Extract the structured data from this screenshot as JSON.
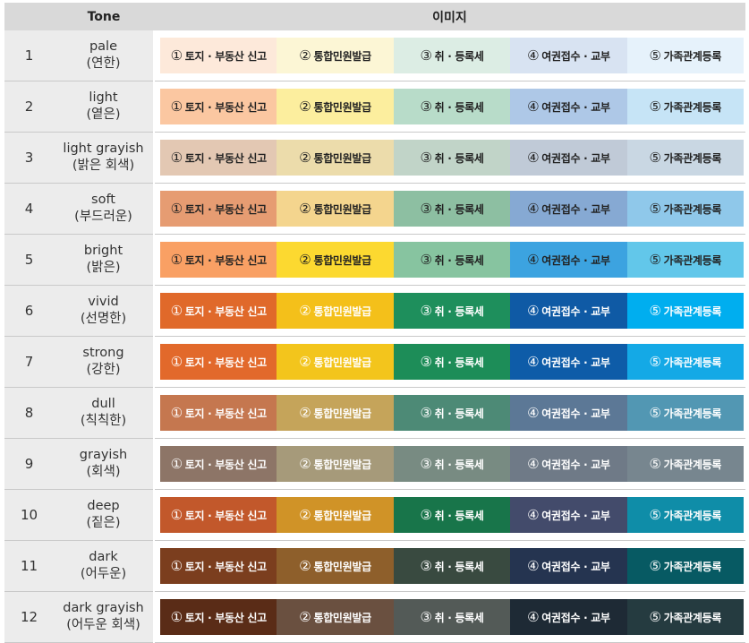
{
  "header": {
    "num": "",
    "tone": "Tone",
    "image": "이미지"
  },
  "labels": [
    {
      "num": "①",
      "text": "토지 · 부동산 신고"
    },
    {
      "num": "②",
      "text": "통합민원발급"
    },
    {
      "num": "③",
      "text": "취 · 등록세"
    },
    {
      "num": "④",
      "text": "여권접수 · 교부"
    },
    {
      "num": "⑤",
      "text": "가족관계등록"
    }
  ],
  "rows": [
    {
      "no": "1",
      "en": "pale",
      "kr": "(연한)",
      "colors": [
        "#fde9da",
        "#fcf6d5",
        "#dcede4",
        "#d8e3f2",
        "#e6f2fb"
      ],
      "text": "#222222"
    },
    {
      "no": "2",
      "en": "light",
      "kr": "(옅은)",
      "colors": [
        "#fbc7a1",
        "#fcee9e",
        "#b8dcc9",
        "#aec8e7",
        "#c6e4f6"
      ],
      "text": "#222222"
    },
    {
      "no": "3",
      "en": "light grayish",
      "kr": "(밝은 회색)",
      "colors": [
        "#e3c8b3",
        "#ecdcab",
        "#c1d4c8",
        "#c0cad7",
        "#c9d7e3"
      ],
      "text": "#222222"
    },
    {
      "no": "4",
      "en": "soft",
      "kr": "(부드러운)",
      "colors": [
        "#e69c72",
        "#f4d58e",
        "#8dbfa2",
        "#86a9d3",
        "#8fc8ea"
      ],
      "text": "#222222"
    },
    {
      "no": "5",
      "en": "bright",
      "kr": "(밝은)",
      "colors": [
        "#f9a064",
        "#fcd930",
        "#87c4a0",
        "#3ca3e0",
        "#62c7ea"
      ],
      "text": "#222222"
    },
    {
      "no": "6",
      "en": "vivid",
      "kr": "(선명한)",
      "colors": [
        "#e0692a",
        "#f4c01a",
        "#1e8f5c",
        "#0f5aa5",
        "#00aeef"
      ],
      "text": "#ffffff"
    },
    {
      "no": "7",
      "en": "strong",
      "kr": "(강한)",
      "colors": [
        "#e2692b",
        "#f3c51c",
        "#1d8d58",
        "#0e5ca8",
        "#14a9e6"
      ],
      "text": "#ffffff"
    },
    {
      "no": "8",
      "en": "dull",
      "kr": "(칙칙한)",
      "colors": [
        "#c5774f",
        "#c5a45a",
        "#4d8a76",
        "#5c7896",
        "#5297b3"
      ],
      "text": "#ffffff"
    },
    {
      "no": "9",
      "en": "grayish",
      "kr": "(회색)",
      "colors": [
        "#8d7567",
        "#a69a7a",
        "#788b82",
        "#6f7a87",
        "#77868f"
      ],
      "text": "#ffffff"
    },
    {
      "no": "10",
      "en": "deep",
      "kr": "(짙은)",
      "colors": [
        "#c2582b",
        "#d09327",
        "#18754a",
        "#434b6b",
        "#0f8da8"
      ],
      "text": "#ffffff"
    },
    {
      "no": "11",
      "en": "dark",
      "kr": "(어두운)",
      "colors": [
        "#7b3e1e",
        "#8e5f2b",
        "#394a40",
        "#253450",
        "#075a63"
      ],
      "text": "#ffffff"
    },
    {
      "no": "12",
      "en": "dark grayish",
      "kr": "(어두운 회색)",
      "colors": [
        "#5a2c17",
        "#6a5040",
        "#535a57",
        "#1e2a35",
        "#253b40"
      ],
      "text": "#ffffff"
    }
  ]
}
